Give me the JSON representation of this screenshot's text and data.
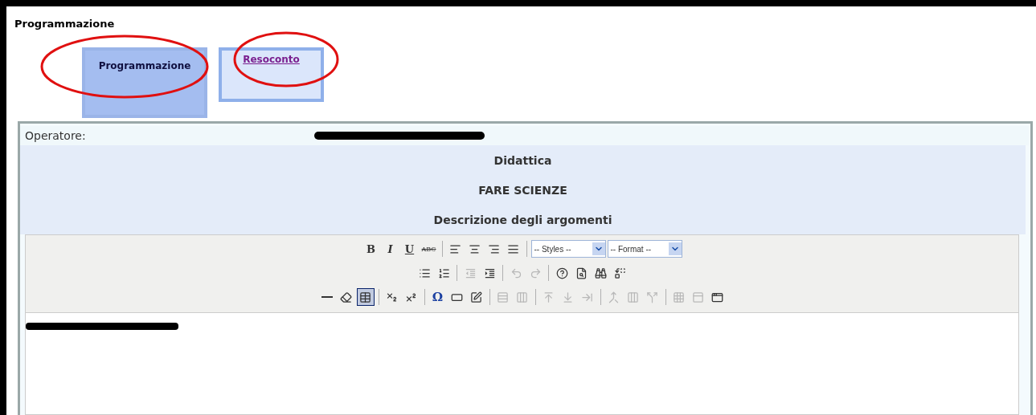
{
  "page_title": "Programmazione",
  "tabs": [
    {
      "label": "Programmazione",
      "selected": true,
      "circled": true
    },
    {
      "label": "Resoconto",
      "selected": false,
      "circled": true
    }
  ],
  "operator": {
    "label": "Operatore:",
    "value_redacted": true
  },
  "headers": [
    "Didattica",
    "FARE SCIENZE",
    "Descrizione degli argomenti"
  ],
  "toolbar_rows": [
    [
      {
        "kind": "text",
        "label": "B"
      },
      {
        "kind": "text",
        "label": "I"
      },
      {
        "kind": "text",
        "label": "U"
      },
      {
        "kind": "text",
        "label": "ABC"
      },
      {
        "kind": "sep"
      },
      {
        "kind": "icon",
        "disabled": false
      },
      {
        "kind": "icon",
        "disabled": false
      },
      {
        "kind": "icon",
        "disabled": false
      },
      {
        "kind": "icon",
        "disabled": false
      },
      {
        "kind": "sep"
      },
      {
        "kind": "select",
        "label": "-- Styles --"
      },
      {
        "kind": "select",
        "label": "-- Format --"
      }
    ],
    [
      {
        "kind": "icon",
        "disabled": false
      },
      {
        "kind": "icon",
        "disabled": false
      },
      {
        "kind": "sep"
      },
      {
        "kind": "icon",
        "disabled": true
      },
      {
        "kind": "icon",
        "disabled": false
      },
      {
        "kind": "sep"
      },
      {
        "kind": "icon",
        "disabled": true
      },
      {
        "kind": "icon",
        "disabled": true
      },
      {
        "kind": "sep"
      },
      {
        "kind": "icon",
        "disabled": false
      },
      {
        "kind": "icon",
        "disabled": false
      },
      {
        "kind": "icon",
        "disabled": false
      },
      {
        "kind": "icon",
        "disabled": false
      }
    ],
    [
      {
        "kind": "icon",
        "disabled": false
      },
      {
        "kind": "icon",
        "disabled": false
      },
      {
        "kind": "icon",
        "disabled": false,
        "selected": true
      },
      {
        "kind": "sep"
      },
      {
        "kind": "icon",
        "disabled": false
      },
      {
        "kind": "icon",
        "disabled": false
      },
      {
        "kind": "sep"
      },
      {
        "kind": "text",
        "label": "Ω"
      },
      {
        "kind": "icon",
        "disabled": false
      },
      {
        "kind": "icon",
        "disabled": false
      },
      {
        "kind": "sep"
      },
      {
        "kind": "icon",
        "disabled": true
      },
      {
        "kind": "icon",
        "disabled": true
      },
      {
        "kind": "sep"
      },
      {
        "kind": "icon",
        "disabled": true
      },
      {
        "kind": "icon",
        "disabled": true
      },
      {
        "kind": "icon",
        "disabled": true
      },
      {
        "kind": "sep"
      },
      {
        "kind": "icon",
        "disabled": true
      },
      {
        "kind": "icon",
        "disabled": true
      },
      {
        "kind": "icon",
        "disabled": true
      },
      {
        "kind": "sep"
      },
      {
        "kind": "icon",
        "disabled": true
      },
      {
        "kind": "icon",
        "disabled": true
      },
      {
        "kind": "icon",
        "disabled": false
      }
    ]
  ],
  "editor": {
    "content_redacted": true
  }
}
